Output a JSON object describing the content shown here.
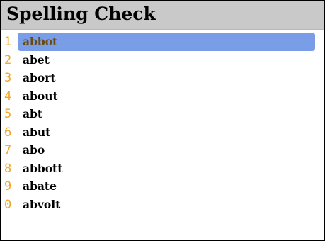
{
  "screen": {
    "title": "Spelling Check"
  },
  "colors": {
    "titlebar_bg": "#c9c9c9",
    "selection_bg": "#7a9de8",
    "number_color": "#f4a623",
    "selected_text": "#6b4a12"
  },
  "suggestions": [
    {
      "number": "1",
      "word": "abbot",
      "selected": true
    },
    {
      "number": "2",
      "word": "abet",
      "selected": false
    },
    {
      "number": "3",
      "word": "abort",
      "selected": false
    },
    {
      "number": "4",
      "word": "about",
      "selected": false
    },
    {
      "number": "5",
      "word": "abt",
      "selected": false
    },
    {
      "number": "6",
      "word": "abut",
      "selected": false
    },
    {
      "number": "7",
      "word": "abo",
      "selected": false
    },
    {
      "number": "8",
      "word": "abbott",
      "selected": false
    },
    {
      "number": "9",
      "word": "abate",
      "selected": false
    },
    {
      "number": "0",
      "word": "abvolt",
      "selected": false
    }
  ]
}
